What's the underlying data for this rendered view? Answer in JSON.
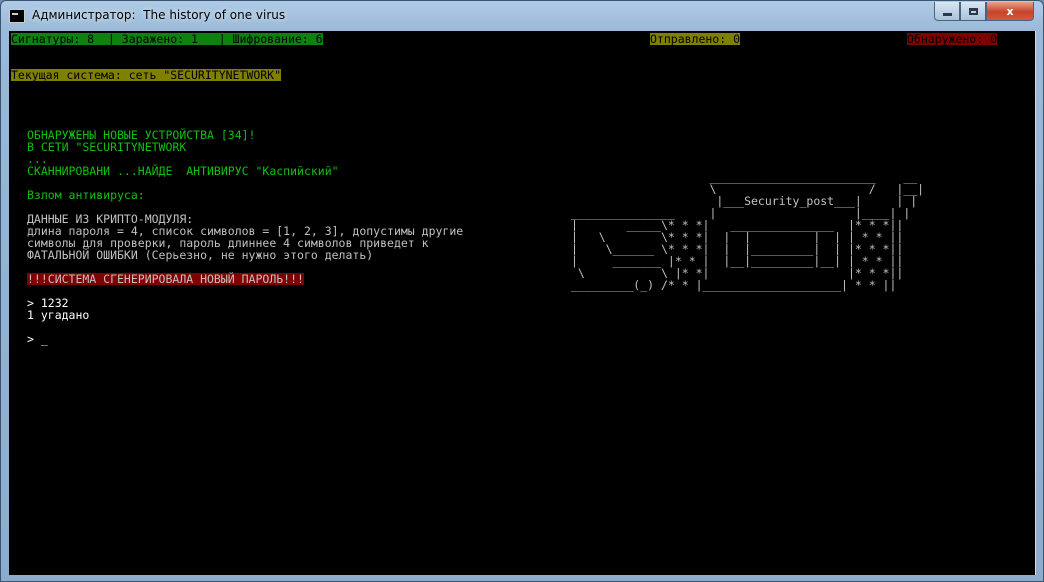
{
  "window": {
    "title": "Администратор:  The history of one virus",
    "min_label": "",
    "max_label": "",
    "close_label": "x"
  },
  "status": {
    "signatures": "Сигнатуры: 8  | Заражено: 1   | Шифрование: 6",
    "sent": "Отправлено: 0",
    "detected": "Обнаружено: 0"
  },
  "system": {
    "current": "Текущая система: сеть \"SECURITYNETWORK\""
  },
  "log": [
    "ОБНАРУЖЕНЫ НОВЫЕ УСТРОЙСТВА [34]!",
    "В СЕТИ \"SECURITYNETWORK",
    "...",
    "СКАННИРОВАНИ ...НАЙДЕ  АНТИВИРУС \"Каспийский\""
  ],
  "hack": {
    "title": "Взлом антивируса:",
    "crypto_lines": [
      "ДАННЫЕ ИЗ КРИПТО-МОДУЛЯ:",
      "длина пароля = 4, список символов = [1, 2, 3], допустимы другие",
      "символы для проверки, пароль длиннее 4 символов приведет к",
      "ФАТАЛЬНОЙ ОШИБКИ (Серьезно, не нужно этого делать)"
    ],
    "alert": "!!!СИСТЕМА СГЕНЕРИРОВАЛА НОВЫЙ ПАРОЛЬ!!!"
  },
  "session": {
    "input_line": "> 1232",
    "result_line": "1 угадано",
    "prompt": "> ",
    "cursor": "_"
  },
  "ascii_art": [
    "                    ________________________    __",
    "                    \\                      /   |__|",
    "                     |___Security_post___|     | |",
    "_______________     |                    |____| |",
    "|       _____\\* * *|   _______________  |* * *||",
    "|   \\        \\* * *|  |  |         |  | | * * ||",
    "|    \\______ \\* * *|  |  |_________|  | |* * *||",
    "|     _______ |* * |  |__|_________|__| | * * ||",
    " \\           \\ |* *|                    |* * *||",
    "_________(_) /* * |____________________| * * ||"
  ],
  "colors": {
    "console_bg": "#000000",
    "green_bar": "#108010",
    "yellow_bar": "#808000",
    "red_bar": "#800000",
    "green_text": "#10c010",
    "gray_text": "#c0c0c0"
  }
}
